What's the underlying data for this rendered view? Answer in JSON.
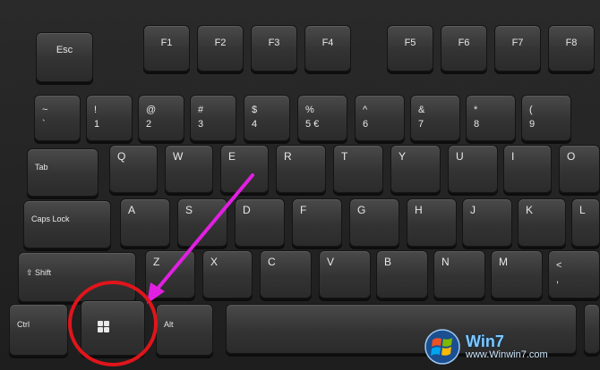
{
  "keys": {
    "esc": "Esc",
    "f1": "F1",
    "f2": "F2",
    "f3": "F3",
    "f4": "F4",
    "f5": "F5",
    "f6": "F6",
    "f7": "F7",
    "f8": "F8",
    "tilde": "~\n`",
    "n1": "!\n1",
    "n2": "@\n2",
    "n3": "#\n3",
    "n4": "$\n4",
    "n5": "%\n5 €",
    "n6": "^\n6",
    "n7": "&\n7",
    "n8": "*\n8",
    "n9": "(\n9",
    "tab": "Tab",
    "q": "Q",
    "w": "W",
    "e": "E",
    "r": "R",
    "t": "T",
    "y": "Y",
    "u": "U",
    "i": "I",
    "o": "O",
    "caps": "Caps Lock",
    "a": "A",
    "s": "S",
    "d": "D",
    "f": "F",
    "g": "G",
    "h": "H",
    "j": "J",
    "k": "K",
    "l": "L",
    "shift": "⇧ Shift",
    "z": "Z",
    "x": "X",
    "c": "C",
    "v": "V",
    "b": "B",
    "n": "N",
    "m": "M",
    "comma": "<\n,",
    "ctrl": "Ctrl",
    "alt": "Alt"
  },
  "annotation": {
    "color": "#e020e0",
    "circle_color": "#e0151b"
  },
  "watermark": {
    "title": "Win7",
    "sub": "www.Winwin7.com"
  },
  "icons": {
    "win_key": "windows-logo-icon",
    "watermark": "windows-flag-icon"
  }
}
